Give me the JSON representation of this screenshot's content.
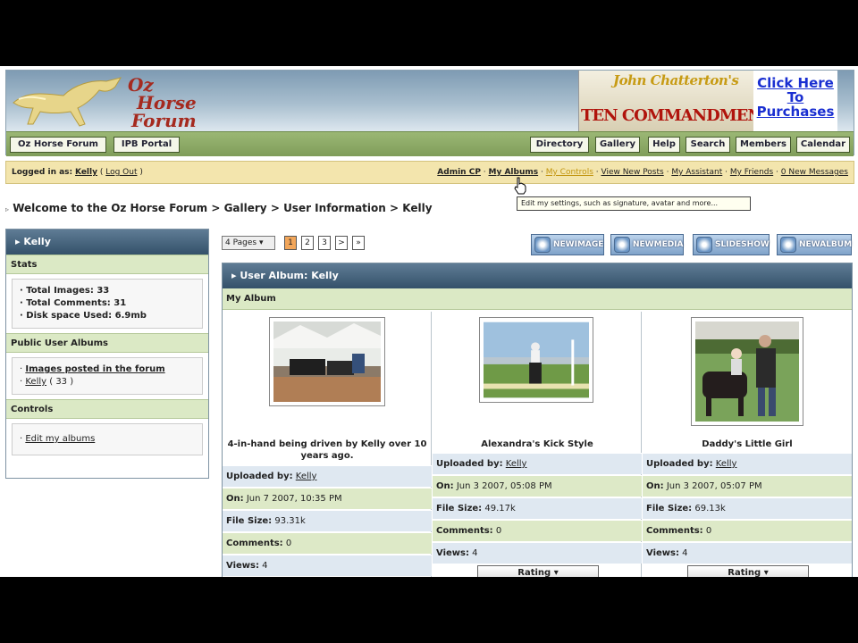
{
  "logo": {
    "line1": "Oz",
    "line2": "Horse",
    "line3": "Forum"
  },
  "ad": {
    "script": "John Chatterton's",
    "title": "TEN COMMANDMENTS",
    "link1": "Click Here",
    "link2": "To",
    "link3": "Purchases"
  },
  "nav_left": [
    "Oz Horse Forum",
    "IPB Portal"
  ],
  "nav_right": [
    "Directory",
    "Gallery",
    "Help",
    "Search",
    "Members",
    "Calendar"
  ],
  "userbar": {
    "logged_in_as": "Logged in as:",
    "user": "Kelly",
    "logout": "Log Out",
    "links": [
      "Admin CP",
      "My Albums",
      "My Controls",
      "View New Posts",
      "My Assistant",
      "My Friends",
      "0 New Messages"
    ]
  },
  "tooltip": "Edit my settings, such as signature, avatar and more...",
  "breadcrumb": [
    "Welcome to the Oz Horse Forum",
    "Gallery",
    "User Information",
    "Kelly"
  ],
  "sidebar": {
    "title": "Kelly",
    "stats_title": "Stats",
    "stats": [
      "Total Images: 33",
      "Total Comments: 31",
      "Disk space Used: 6.9mb"
    ],
    "albums_title": "Public User Albums",
    "album_link": "Images posted in the forum",
    "album_user": "Kelly",
    "album_count": "( 33 )",
    "controls_title": "Controls",
    "controls_link": "Edit my albums"
  },
  "pagination": {
    "dropdown": "4 Pages",
    "pages": [
      "1",
      "2",
      "3",
      ">",
      "»"
    ],
    "current": "1"
  },
  "actions": [
    "NEWIMAGE",
    "NEWMEDIA",
    "SLIDESHOW",
    "NEWALBUM"
  ],
  "album": {
    "title": "User Album: Kelly",
    "subtitle": "My Album",
    "labels": {
      "uploaded": "Uploaded by:",
      "on": "On:",
      "size": "File Size:",
      "comments": "Comments:",
      "views": "Views:",
      "rating": "Rating"
    },
    "items": [
      {
        "caption": "4-in-hand being driven by Kelly over 10 years ago.",
        "user": "Kelly",
        "date": "Jun 7 2007, 10:35 PM",
        "size": "93.31k",
        "comments": "0",
        "views": "4"
      },
      {
        "caption": "Alexandra's Kick Style",
        "user": "Kelly",
        "date": "Jun 3 2007, 05:08 PM",
        "size": "49.17k",
        "comments": "0",
        "views": "4"
      },
      {
        "caption": "Daddy's Little Girl",
        "user": "Kelly",
        "date": "Jun 3 2007, 05:07 PM",
        "size": "69.13k",
        "comments": "0",
        "views": "4"
      }
    ]
  }
}
